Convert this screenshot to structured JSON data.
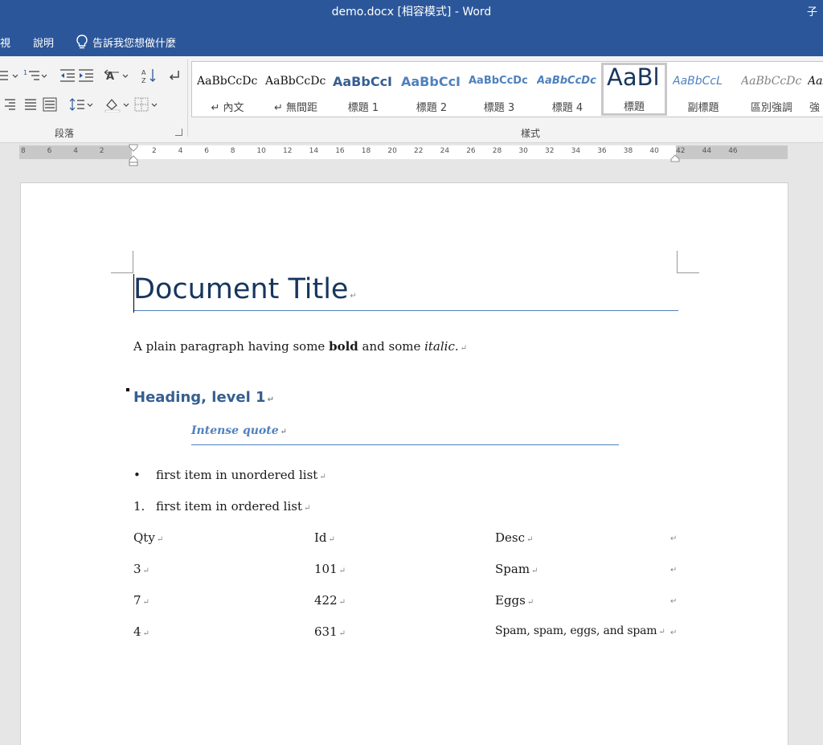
{
  "titlebar": {
    "title": "demo.docx [相容模式]  -  Word",
    "user": "子"
  },
  "menu": {
    "items": [
      "視",
      "說明"
    ],
    "tell_me": "告訴我您想做什麼"
  },
  "ribbon": {
    "groups": {
      "paragraph": "段落",
      "styles": "樣式"
    },
    "styles": [
      {
        "sample": "AaBbCcDc",
        "label": "↵ 內文"
      },
      {
        "sample": "AaBbCcDc",
        "label": "↵ 無間距"
      },
      {
        "sample": "AaBbCcI",
        "label": "標題 1"
      },
      {
        "sample": "AaBbCcI",
        "label": "標題 2"
      },
      {
        "sample": "AaBbCcDc",
        "label": "標題 3"
      },
      {
        "sample": "AaBbCcDc",
        "label": "標題 4"
      },
      {
        "sample": "AaBl",
        "label": "標題",
        "selected": true
      },
      {
        "sample": "AaBbCcL",
        "label": "副標題"
      },
      {
        "sample": "AaBbCcDc",
        "label": "區別強調"
      },
      {
        "sample": "AaBbCcDc",
        "label": "強"
      }
    ]
  },
  "ruler": {
    "labels": [
      "8",
      "6",
      "4",
      "2",
      "",
      "2",
      "4",
      "6",
      "8",
      "10",
      "12",
      "14",
      "16",
      "18",
      "20",
      "22",
      "24",
      "26",
      "28",
      "30",
      "32",
      "34",
      "36",
      "38",
      "40",
      "42",
      "44",
      "46"
    ]
  },
  "document": {
    "title": "Document Title",
    "paragraph": {
      "before": "A plain paragraph having some ",
      "bold": "bold",
      "middle": " and some ",
      "italic": "italic."
    },
    "heading1": "Heading, level 1",
    "intense_quote": "Intense quote",
    "unordered_list": [
      {
        "marker": "•",
        "text": "first item in unordered list"
      }
    ],
    "ordered_list": [
      {
        "marker": "1.",
        "text": "first item in ordered list"
      }
    ],
    "table": {
      "headers": [
        "Qty",
        "Id",
        "Desc"
      ],
      "rows": [
        [
          "3",
          "101",
          "Spam"
        ],
        [
          "7",
          "422",
          "Eggs"
        ],
        [
          "4",
          "631",
          "Spam, spam, eggs, and spam"
        ]
      ]
    },
    "paragraph_mark": "↵"
  },
  "colors": {
    "word_blue": "#2b579a",
    "title_text": "#17365d",
    "heading_text": "#365f91",
    "accent": "#4f81bd"
  }
}
